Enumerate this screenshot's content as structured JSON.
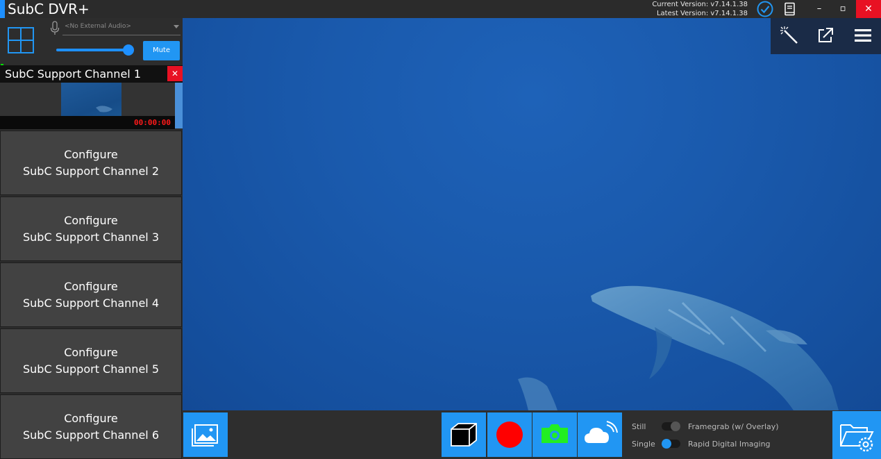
{
  "window": {
    "title": "SubC DVR+",
    "current_version": "Current Version: v7.14.1.38",
    "latest_version": "Latest Version: v7.14.1.38",
    "minimize": "–",
    "maximize": "▫",
    "close": "✕"
  },
  "audio": {
    "source_value": "<No External Audio>",
    "volume_percent": 100,
    "mute_label": "Mute"
  },
  "channel_1": {
    "title": "SubC Support Channel 1",
    "close_label": "✕",
    "timecode": "00:00:00"
  },
  "channels": [
    {
      "line1": "Configure",
      "line2": "SubC Support Channel 2"
    },
    {
      "line1": "Configure",
      "line2": "SubC Support Channel 3"
    },
    {
      "line1": "Configure",
      "line2": "SubC Support Channel 4"
    },
    {
      "line1": "Configure",
      "line2": "SubC Support Channel 5"
    },
    {
      "line1": "Configure",
      "line2": "SubC Support Channel 6"
    }
  ],
  "capture_options": {
    "still_label": "Still",
    "single_label": "Single",
    "framegrab_label": "Framegrab (w/ Overlay)",
    "rapid_label": "Rapid Digital Imaging",
    "still_toggle_on": false,
    "single_toggle_on": true
  },
  "icons": {
    "layout": "grid-icon",
    "microphone": "microphone-icon",
    "update_status": "check-circle-icon",
    "manual": "book-icon",
    "overlay_wand": "magic-wand-icon",
    "popout": "external-link-icon",
    "menu": "hamburger-menu-icon",
    "gallery": "image-gallery-icon",
    "snapshot": "3d-cube-icon",
    "record": "record-icon",
    "photo": "camera-icon",
    "upload": "cloud-upload-icon",
    "folder": "folder-settings-icon"
  },
  "colors": {
    "accent": "#2196f3",
    "close_red": "#e81123",
    "record_red": "#ff0000",
    "camera_green": "#22ee22",
    "timecode_red": "#ff1a1a"
  }
}
